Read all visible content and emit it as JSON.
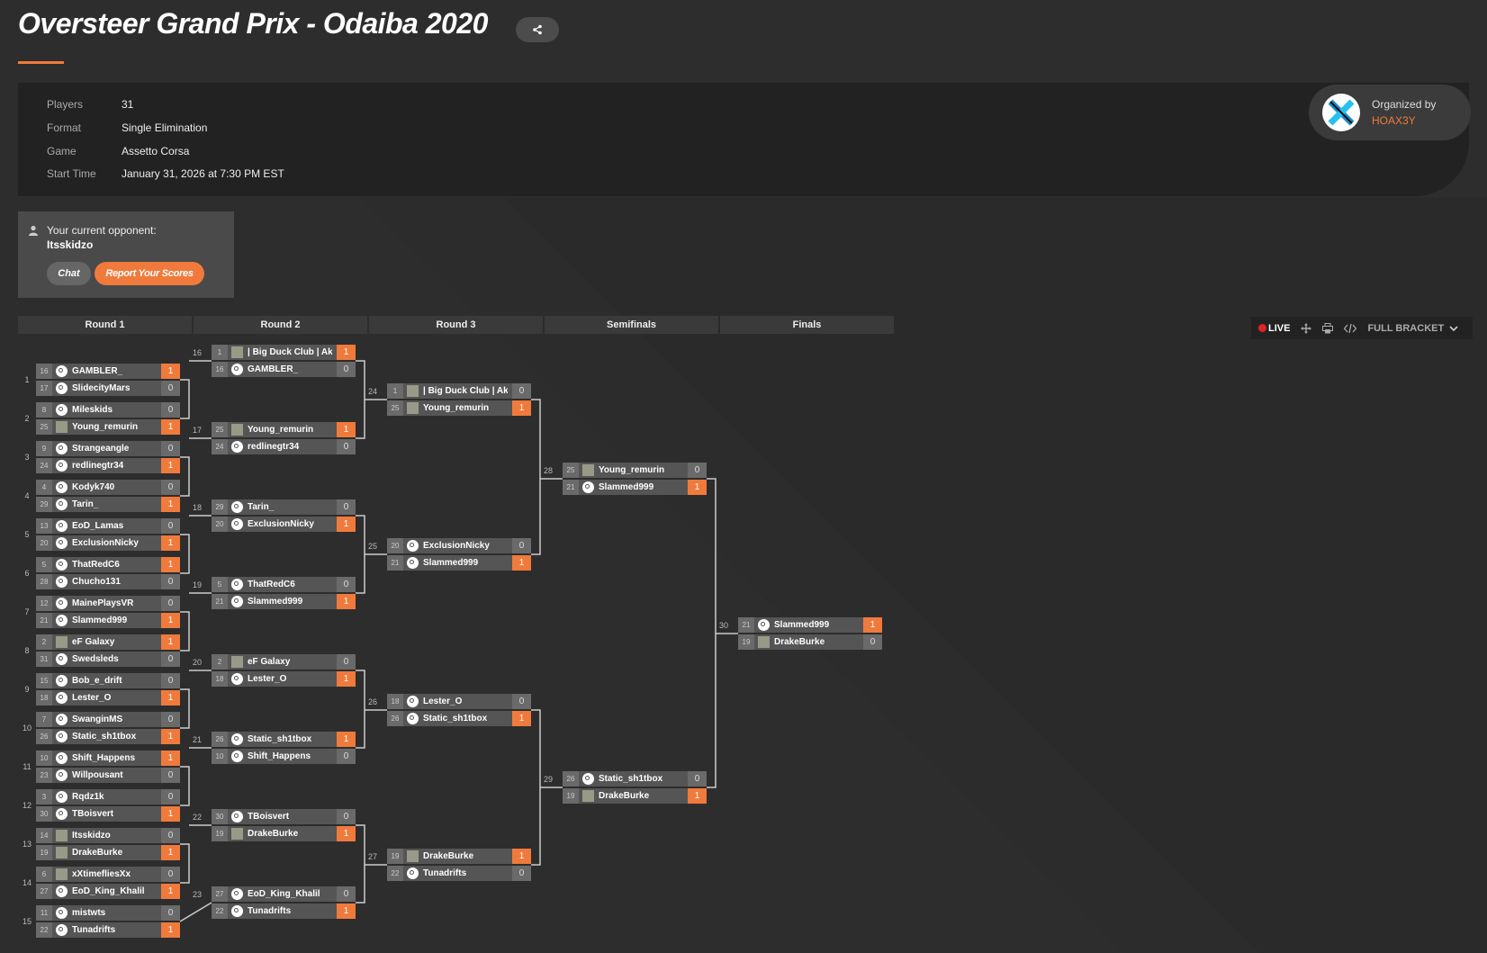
{
  "header": {
    "title": "Oversteer Grand Prix - Odaiba 2020",
    "share_icon": "share-icon",
    "accent_color": "#f07a3c"
  },
  "info": [
    {
      "label": "Players",
      "value": "31"
    },
    {
      "label": "Format",
      "value": "Single Elimination"
    },
    {
      "label": "Game",
      "value": "Assetto Corsa"
    },
    {
      "label": "Start Time",
      "value": "January 31, 2026 at 7:30 PM EST"
    }
  ],
  "organizer": {
    "label": "Organized by",
    "name": "HOAX3Y"
  },
  "opponent": {
    "label": "Your current opponent:",
    "name": "Itsskidzo",
    "chat_label": "Chat",
    "report_label": "Report Your Scores"
  },
  "rounds": [
    "Round 1",
    "Round 2",
    "Round 3",
    "Semifinals",
    "Finals"
  ],
  "toolbar": {
    "live_label": "LIVE",
    "full_bracket_label": "FULL BRACKET"
  },
  "matches": [
    {
      "num": "1",
      "round": 0,
      "players": [
        {
          "seed": "16",
          "name": "GAMBLER_",
          "score": "1",
          "win": true,
          "av": "steam"
        },
        {
          "seed": "17",
          "name": "SlidecityMars",
          "score": "0",
          "win": false,
          "av": "steam"
        }
      ]
    },
    {
      "num": "2",
      "round": 0,
      "players": [
        {
          "seed": "8",
          "name": "Mileskids",
          "score": "0",
          "win": false,
          "av": "steam"
        },
        {
          "seed": "25",
          "name": "Young_remurin",
          "score": "1",
          "win": true,
          "av": "custom"
        }
      ]
    },
    {
      "num": "3",
      "round": 0,
      "players": [
        {
          "seed": "9",
          "name": "Strangeangle",
          "score": "0",
          "win": false,
          "av": "steam"
        },
        {
          "seed": "24",
          "name": "redlinegtr34",
          "score": "1",
          "win": true,
          "av": "steam"
        }
      ]
    },
    {
      "num": "4",
      "round": 0,
      "players": [
        {
          "seed": "4",
          "name": "Kodyk740",
          "score": "0",
          "win": false,
          "av": "steam"
        },
        {
          "seed": "29",
          "name": "Tarin_",
          "score": "1",
          "win": true,
          "av": "steam"
        }
      ]
    },
    {
      "num": "5",
      "round": 0,
      "players": [
        {
          "seed": "13",
          "name": "EoD_Lamas",
          "score": "0",
          "win": false,
          "av": "steam"
        },
        {
          "seed": "20",
          "name": "ExclusionNicky",
          "score": "1",
          "win": true,
          "av": "steam"
        }
      ]
    },
    {
      "num": "6",
      "round": 0,
      "players": [
        {
          "seed": "5",
          "name": "ThatRedC6",
          "score": "1",
          "win": true,
          "av": "steam"
        },
        {
          "seed": "28",
          "name": "Chucho131",
          "score": "0",
          "win": false,
          "av": "steam"
        }
      ]
    },
    {
      "num": "7",
      "round": 0,
      "players": [
        {
          "seed": "12",
          "name": "MainePlaysVR",
          "score": "0",
          "win": false,
          "av": "steam"
        },
        {
          "seed": "21",
          "name": "Slammed999",
          "score": "1",
          "win": true,
          "av": "steam"
        }
      ]
    },
    {
      "num": "8",
      "round": 0,
      "players": [
        {
          "seed": "2",
          "name": "eF Galaxy",
          "score": "1",
          "win": true,
          "av": "custom"
        },
        {
          "seed": "31",
          "name": "Swedsleds",
          "score": "0",
          "win": false,
          "av": "steam"
        }
      ]
    },
    {
      "num": "9",
      "round": 0,
      "players": [
        {
          "seed": "15",
          "name": "Bob_e_drift",
          "score": "0",
          "win": false,
          "av": "steam"
        },
        {
          "seed": "18",
          "name": "Lester_O",
          "score": "1",
          "win": true,
          "av": "steam"
        }
      ]
    },
    {
      "num": "10",
      "round": 0,
      "players": [
        {
          "seed": "7",
          "name": "SwanginMS",
          "score": "0",
          "win": false,
          "av": "steam"
        },
        {
          "seed": "26",
          "name": "Static_sh1tbox",
          "score": "1",
          "win": true,
          "av": "steam"
        }
      ]
    },
    {
      "num": "11",
      "round": 0,
      "players": [
        {
          "seed": "10",
          "name": "Shift_Happens",
          "score": "1",
          "win": true,
          "av": "steam"
        },
        {
          "seed": "23",
          "name": "Willpousant",
          "score": "0",
          "win": false,
          "av": "steam"
        }
      ]
    },
    {
      "num": "12",
      "round": 0,
      "players": [
        {
          "seed": "3",
          "name": "Rqdz1k",
          "score": "0",
          "win": false,
          "av": "steam"
        },
        {
          "seed": "30",
          "name": "TBoisvert",
          "score": "1",
          "win": true,
          "av": "steam"
        }
      ]
    },
    {
      "num": "13",
      "round": 0,
      "players": [
        {
          "seed": "14",
          "name": "Itsskidzo",
          "score": "0",
          "win": false,
          "av": "custom"
        },
        {
          "seed": "19",
          "name": "DrakeBurke",
          "score": "1",
          "win": true,
          "av": "custom"
        }
      ]
    },
    {
      "num": "14",
      "round": 0,
      "players": [
        {
          "seed": "6",
          "name": "xXtimefliesXx",
          "score": "0",
          "win": false,
          "av": "custom"
        },
        {
          "seed": "27",
          "name": "EoD_King_Khalil",
          "score": "1",
          "win": true,
          "av": "steam"
        }
      ]
    },
    {
      "num": "15",
      "round": 0,
      "players": [
        {
          "seed": "11",
          "name": "mistwts",
          "score": "0",
          "win": false,
          "av": "steam"
        },
        {
          "seed": "22",
          "name": "Tunadrifts",
          "score": "1",
          "win": true,
          "av": "steam"
        }
      ]
    },
    {
      "num": "16",
      "round": 1,
      "players": [
        {
          "seed": "1",
          "name": "| Big Duck Club | Aku",
          "score": "1",
          "win": true,
          "av": "custom"
        },
        {
          "seed": "16",
          "name": "GAMBLER_",
          "score": "0",
          "win": false,
          "av": "steam"
        }
      ]
    },
    {
      "num": "17",
      "round": 1,
      "players": [
        {
          "seed": "25",
          "name": "Young_remurin",
          "score": "1",
          "win": true,
          "av": "custom"
        },
        {
          "seed": "24",
          "name": "redlinegtr34",
          "score": "0",
          "win": false,
          "av": "steam"
        }
      ]
    },
    {
      "num": "18",
      "round": 1,
      "players": [
        {
          "seed": "29",
          "name": "Tarin_",
          "score": "0",
          "win": false,
          "av": "steam"
        },
        {
          "seed": "20",
          "name": "ExclusionNicky",
          "score": "1",
          "win": true,
          "av": "steam"
        }
      ]
    },
    {
      "num": "19",
      "round": 1,
      "players": [
        {
          "seed": "5",
          "name": "ThatRedC6",
          "score": "0",
          "win": false,
          "av": "steam"
        },
        {
          "seed": "21",
          "name": "Slammed999",
          "score": "1",
          "win": true,
          "av": "steam"
        }
      ]
    },
    {
      "num": "20",
      "round": 1,
      "players": [
        {
          "seed": "2",
          "name": "eF Galaxy",
          "score": "0",
          "win": false,
          "av": "custom"
        },
        {
          "seed": "18",
          "name": "Lester_O",
          "score": "1",
          "win": true,
          "av": "steam"
        }
      ]
    },
    {
      "num": "21",
      "round": 1,
      "players": [
        {
          "seed": "26",
          "name": "Static_sh1tbox",
          "score": "1",
          "win": true,
          "av": "steam"
        },
        {
          "seed": "10",
          "name": "Shift_Happens",
          "score": "0",
          "win": false,
          "av": "steam"
        }
      ]
    },
    {
      "num": "22",
      "round": 1,
      "players": [
        {
          "seed": "30",
          "name": "TBoisvert",
          "score": "0",
          "win": false,
          "av": "steam"
        },
        {
          "seed": "19",
          "name": "DrakeBurke",
          "score": "1",
          "win": true,
          "av": "custom"
        }
      ]
    },
    {
      "num": "23",
      "round": 1,
      "players": [
        {
          "seed": "27",
          "name": "EoD_King_Khalil",
          "score": "0",
          "win": false,
          "av": "steam"
        },
        {
          "seed": "22",
          "name": "Tunadrifts",
          "score": "1",
          "win": true,
          "av": "steam"
        }
      ]
    },
    {
      "num": "24",
      "round": 2,
      "players": [
        {
          "seed": "1",
          "name": "| Big Duck Club | Aku",
          "score": "0",
          "win": false,
          "av": "custom"
        },
        {
          "seed": "25",
          "name": "Young_remurin",
          "score": "1",
          "win": true,
          "av": "custom"
        }
      ]
    },
    {
      "num": "25",
      "round": 2,
      "players": [
        {
          "seed": "20",
          "name": "ExclusionNicky",
          "score": "0",
          "win": false,
          "av": "steam"
        },
        {
          "seed": "21",
          "name": "Slammed999",
          "score": "1",
          "win": true,
          "av": "steam"
        }
      ]
    },
    {
      "num": "26",
      "round": 2,
      "players": [
        {
          "seed": "18",
          "name": "Lester_O",
          "score": "0",
          "win": false,
          "av": "steam"
        },
        {
          "seed": "26",
          "name": "Static_sh1tbox",
          "score": "1",
          "win": true,
          "av": "steam"
        }
      ]
    },
    {
      "num": "27",
      "round": 2,
      "players": [
        {
          "seed": "19",
          "name": "DrakeBurke",
          "score": "1",
          "win": true,
          "av": "custom"
        },
        {
          "seed": "22",
          "name": "Tunadrifts",
          "score": "0",
          "win": false,
          "av": "steam"
        }
      ]
    },
    {
      "num": "28",
      "round": 3,
      "players": [
        {
          "seed": "25",
          "name": "Young_remurin",
          "score": "0",
          "win": false,
          "av": "custom"
        },
        {
          "seed": "21",
          "name": "Slammed999",
          "score": "1",
          "win": true,
          "av": "steam"
        }
      ]
    },
    {
      "num": "29",
      "round": 3,
      "players": [
        {
          "seed": "26",
          "name": "Static_sh1tbox",
          "score": "0",
          "win": false,
          "av": "steam"
        },
        {
          "seed": "19",
          "name": "DrakeBurke",
          "score": "1",
          "win": true,
          "av": "custom"
        }
      ]
    },
    {
      "num": "30",
      "round": 4,
      "players": [
        {
          "seed": "21",
          "name": "Slammed999",
          "score": "1",
          "win": true,
          "av": "steam"
        },
        {
          "seed": "19",
          "name": "DrakeBurke",
          "score": "0",
          "win": false,
          "av": "custom"
        }
      ]
    }
  ]
}
